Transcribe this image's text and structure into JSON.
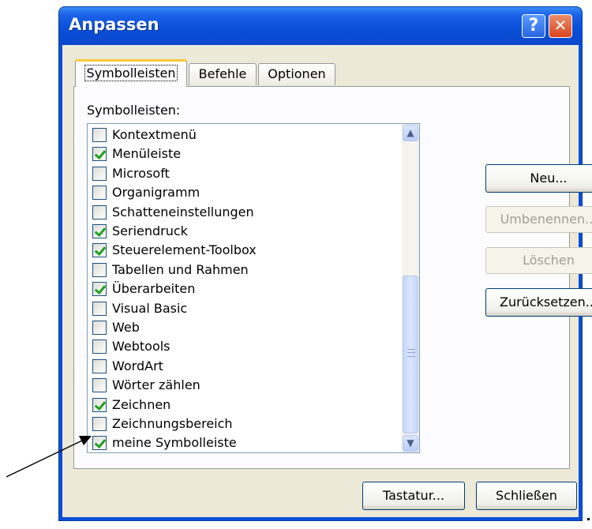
{
  "window": {
    "title": "Anpassen",
    "help_label": "?",
    "close_label": "✕"
  },
  "tabs": [
    {
      "label": "Symbolleisten",
      "active": true
    },
    {
      "label": "Befehle",
      "active": false
    },
    {
      "label": "Optionen",
      "active": false
    }
  ],
  "list": {
    "label": "Symbolleisten:",
    "items": [
      {
        "label": "Kontextmenü",
        "checked": false
      },
      {
        "label": "Menüleiste",
        "checked": true
      },
      {
        "label": "Microsoft",
        "checked": false
      },
      {
        "label": "Organigramm",
        "checked": false
      },
      {
        "label": "Schatteneinstellungen",
        "checked": false
      },
      {
        "label": "Seriendruck",
        "checked": true
      },
      {
        "label": "Steuerelement-Toolbox",
        "checked": true
      },
      {
        "label": "Tabellen und Rahmen",
        "checked": false
      },
      {
        "label": "Überarbeiten",
        "checked": true
      },
      {
        "label": "Visual Basic",
        "checked": false
      },
      {
        "label": "Web",
        "checked": false
      },
      {
        "label": "Webtools",
        "checked": false
      },
      {
        "label": "WordArt",
        "checked": false
      },
      {
        "label": "Wörter zählen",
        "checked": false
      },
      {
        "label": "Zeichnen",
        "checked": true
      },
      {
        "label": "Zeichnungsbereich",
        "checked": false
      },
      {
        "label": "meine Symbolleiste",
        "checked": true
      }
    ]
  },
  "buttons": {
    "new": "Neu...",
    "rename": "Umbenennen...",
    "delete": "Löschen",
    "reset": "Zurücksetzen...",
    "keyboard": "Tastatur...",
    "close": "Schließen"
  },
  "colors": {
    "titlebar": "#0a4fd8",
    "dialog_face": "#ece9d8",
    "check_green": "#21a121",
    "tab_highlight": "#ffc83c"
  },
  "icons": {
    "help": "help-icon",
    "close": "close-icon",
    "scroll_up": "chevron-up-icon",
    "scroll_down": "chevron-down-icon",
    "annotation": "arrow-icon"
  }
}
